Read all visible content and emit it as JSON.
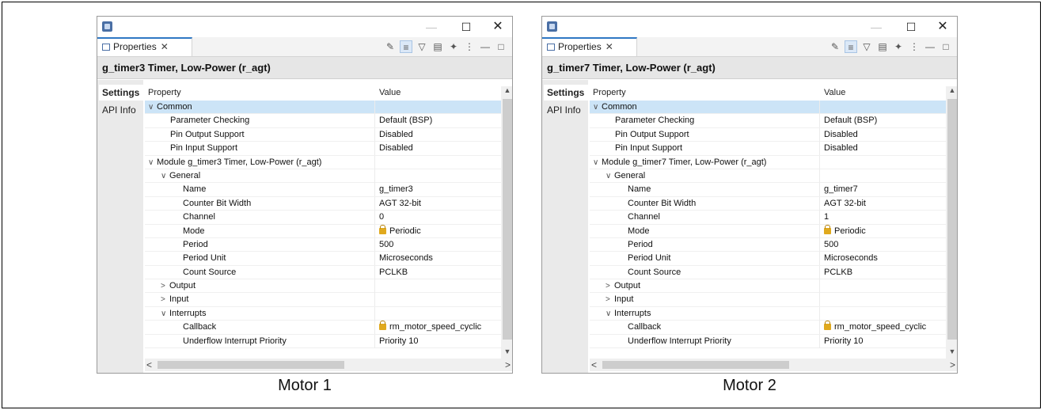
{
  "panels": [
    {
      "tab_label": "Properties",
      "module_title": "g_timer3 Timer, Low-Power (r_agt)",
      "side_tabs": [
        "Settings",
        "API Info"
      ],
      "col_property": "Property",
      "col_value": "Value",
      "rows": [
        {
          "label": "Common",
          "value": "",
          "chevron": "∨"
        },
        {
          "label": "Parameter Checking",
          "value": "Default (BSP)"
        },
        {
          "label": "Pin Output Support",
          "value": "Disabled"
        },
        {
          "label": "Pin Input Support",
          "value": "Disabled"
        },
        {
          "label": "Module g_timer3 Timer, Low-Power (r_agt)",
          "value": "",
          "chevron": "∨"
        },
        {
          "label": "General",
          "value": "",
          "chevron": "∨"
        },
        {
          "label": "Name",
          "value": "g_timer3"
        },
        {
          "label": "Counter Bit Width",
          "value": "AGT 32-bit"
        },
        {
          "label": "Channel",
          "value": "0"
        },
        {
          "label": "Mode",
          "value": "Periodic"
        },
        {
          "label": "Period",
          "value": "500"
        },
        {
          "label": "Period Unit",
          "value": "Microseconds"
        },
        {
          "label": "Count Source",
          "value": "PCLKB"
        },
        {
          "label": "Output",
          "value": "",
          "chevron": ">"
        },
        {
          "label": "Input",
          "value": "",
          "chevron": ">"
        },
        {
          "label": "Interrupts",
          "value": "",
          "chevron": "∨"
        },
        {
          "label": "Callback",
          "value": "rm_motor_speed_cyclic"
        },
        {
          "label": "Underflow Interrupt Priority",
          "value": "Priority 10"
        }
      ],
      "caption": "Motor 1"
    },
    {
      "tab_label": "Properties",
      "module_title": "g_timer7 Timer, Low-Power (r_agt)",
      "side_tabs": [
        "Settings",
        "API Info"
      ],
      "col_property": "Property",
      "col_value": "Value",
      "rows": [
        {
          "label": "Common",
          "value": "",
          "chevron": "∨"
        },
        {
          "label": "Parameter Checking",
          "value": "Default (BSP)"
        },
        {
          "label": "Pin Output Support",
          "value": "Disabled"
        },
        {
          "label": "Pin Input Support",
          "value": "Disabled"
        },
        {
          "label": "Module g_timer7 Timer, Low-Power (r_agt)",
          "value": "",
          "chevron": "∨"
        },
        {
          "label": "General",
          "value": "",
          "chevron": "∨"
        },
        {
          "label": "Name",
          "value": "g_timer7"
        },
        {
          "label": "Counter Bit Width",
          "value": "AGT 32-bit"
        },
        {
          "label": "Channel",
          "value": "1"
        },
        {
          "label": "Mode",
          "value": "Periodic"
        },
        {
          "label": "Period",
          "value": "500"
        },
        {
          "label": "Period Unit",
          "value": "Microseconds"
        },
        {
          "label": "Count Source",
          "value": "PCLKB"
        },
        {
          "label": "Output",
          "value": "",
          "chevron": ">"
        },
        {
          "label": "Input",
          "value": "",
          "chevron": ">"
        },
        {
          "label": "Interrupts",
          "value": "",
          "chevron": "∨"
        },
        {
          "label": "Callback",
          "value": "rm_motor_speed_cyclic"
        },
        {
          "label": "Underflow Interrupt Priority",
          "value": "Priority 10"
        }
      ],
      "caption": "Motor 2"
    }
  ],
  "icons": {
    "window_close": "✕",
    "window_maximize": "☐",
    "window_minimize": "—",
    "tab_close": "✕",
    "scroll_up": "▲",
    "scroll_down": "▼",
    "scroll_left": "<",
    "scroll_right": ">",
    "locked_value": "lock-icon"
  },
  "colors": {
    "tab_accent": "#2f78c4",
    "selected_row": "#cce4f7",
    "header_bar": "#e6e6e6",
    "lock": "#e0a91d"
  }
}
